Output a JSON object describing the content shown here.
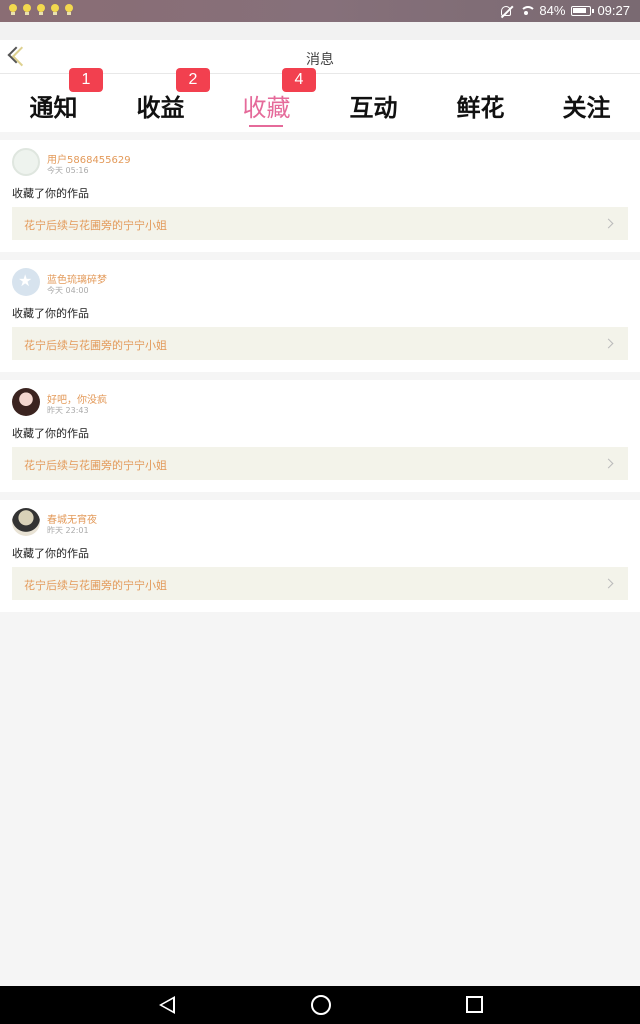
{
  "status_bar": {
    "battery": "84%",
    "time": "09:27",
    "notification_icons": [
      "bulb-icon",
      "bulb-icon",
      "bulb-icon",
      "bulb-icon",
      "bulb-icon"
    ]
  },
  "header": {
    "title": "消息"
  },
  "tabs": [
    {
      "label": "通知",
      "badge": "1",
      "active": false
    },
    {
      "label": "收益",
      "badge": "2",
      "active": false
    },
    {
      "label": "收藏",
      "badge": "4",
      "active": true
    },
    {
      "label": "互动",
      "badge": "",
      "active": false
    },
    {
      "label": "鲜花",
      "badge": "",
      "active": false
    },
    {
      "label": "关注",
      "badge": "",
      "active": false
    }
  ],
  "messages": [
    {
      "user": "用户5868455629",
      "time": "今天 05:16",
      "action": "收藏了你的作品",
      "work": "花宁后续与花圃旁的宁宁小姐"
    },
    {
      "user": "蓝色琉璃碎梦",
      "time": "今天 04:00",
      "action": "收藏了你的作品",
      "work": "花宁后续与花圃旁的宁宁小姐"
    },
    {
      "user": "好吧，你没疯",
      "time": "昨天 23:43",
      "action": "收藏了你的作品",
      "work": "花宁后续与花圃旁的宁宁小姐"
    },
    {
      "user": "春城无宵夜",
      "time": "昨天 22:01",
      "action": "收藏了你的作品",
      "work": "花宁后续与花圃旁的宁宁小姐"
    }
  ],
  "colors": {
    "accent": "#e56a9a",
    "badge": "#f2404f",
    "username": "#e39a5a",
    "work_bg": "#f3f3ea"
  }
}
